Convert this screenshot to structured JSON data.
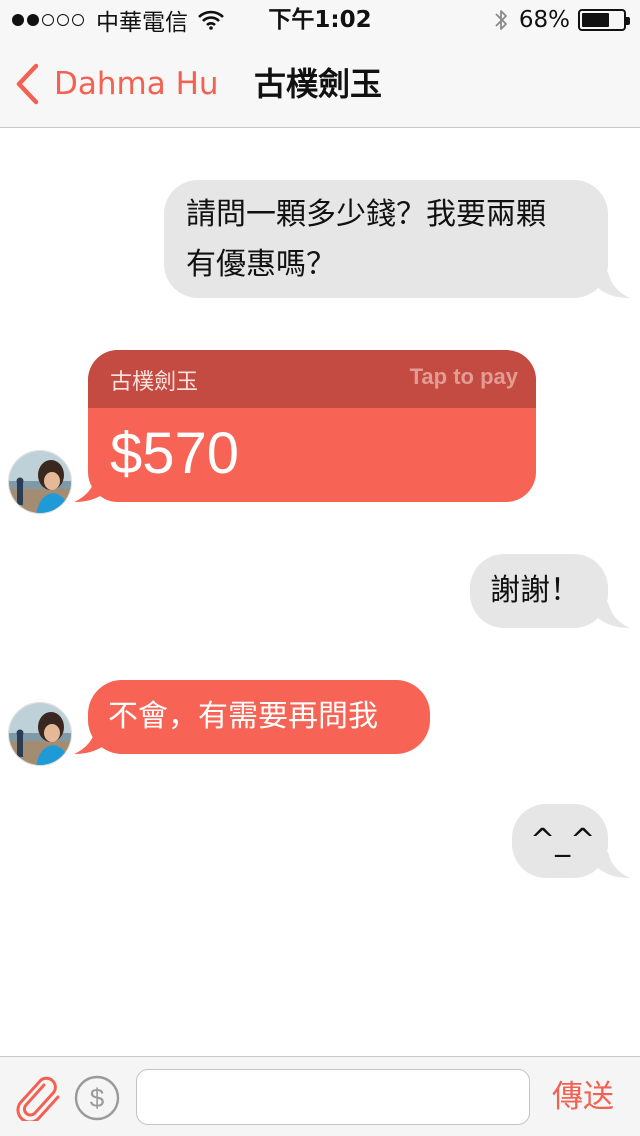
{
  "status_bar": {
    "signal_dots_full": 2,
    "signal_dots_total": 5,
    "carrier": "中華電信",
    "time": "下午1:02",
    "battery_text": "68%",
    "battery_level": 0.68,
    "icons": [
      "wifi-icon",
      "bluetooth-icon",
      "battery-icon"
    ]
  },
  "nav": {
    "back_label": "Dahma Hu",
    "title": "古樸劍玉"
  },
  "messages": [
    {
      "side": "outgoing",
      "text": "請問一顆多少錢？我要兩顆有優惠嗎？",
      "lines": [
        "請問一顆多少錢？我要兩顆",
        "有優惠嗎？"
      ]
    },
    {
      "side": "incoming",
      "type": "payment",
      "item_name": "古樸劍玉",
      "cta": "Tap to pay",
      "amount": "$570"
    },
    {
      "side": "outgoing",
      "text": "謝謝！"
    },
    {
      "side": "incoming",
      "text": "不會，有需要再問我"
    },
    {
      "side": "outgoing",
      "text": "^_^"
    }
  ],
  "input_bar": {
    "attach_icon": "paperclip-icon",
    "pay_icon": "dollar-icon",
    "input_value": "",
    "send_label": "傳送"
  },
  "colors": {
    "accent": "#f26152",
    "incoming_bubble": "#f76354",
    "payment_header": "#c34b42",
    "outgoing_bubble": "#e6e6e6",
    "bar_background": "#f7f7f7"
  }
}
